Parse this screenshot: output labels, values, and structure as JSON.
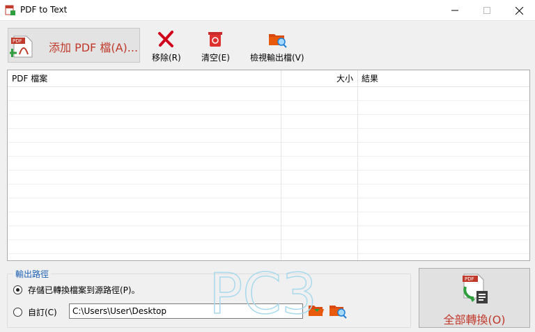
{
  "window": {
    "title": "PDF to Text"
  },
  "toolbar": {
    "add_label": "添加 PDF 檔(A)...",
    "remove_label": "移除(R)",
    "clear_label": "清空(E)",
    "view_label": "檢視輸出檔(V)"
  },
  "list": {
    "columns": [
      "PDF 檔案",
      "大小",
      "結果"
    ],
    "rows": []
  },
  "output": {
    "group_title": "輸出路徑",
    "option_source": "存儲已轉換檔案到源路徑(P)。",
    "option_custom": "自訂(C)",
    "path_value": "C:\\Users\\User\\Desktop",
    "selected": "source"
  },
  "convert": {
    "label": "全部轉換(O)"
  },
  "watermark": {
    "text": "PC3"
  },
  "colors": {
    "accent_red": "#c0392b",
    "group_title_blue": "#1a5fb4"
  }
}
